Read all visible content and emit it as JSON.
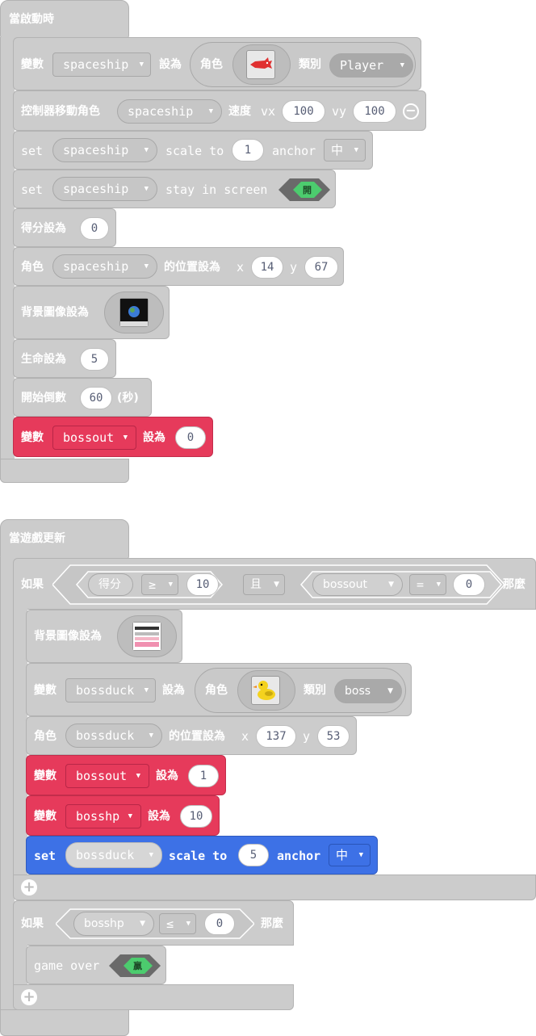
{
  "on_start": {
    "title": "當啟動時",
    "rows": {
      "var_label": "變數",
      "var_value": "spaceship",
      "set_to": "設為",
      "sprite_label": "角色",
      "kind_label": "類別",
      "kind_value": "Player",
      "controller": "控制器移動角色",
      "controller_var": "spaceship",
      "speed": "速度",
      "vx": "vx",
      "vx_val": "100",
      "vy": "vy",
      "vy_val": "100",
      "set": "set",
      "scale_var": "spaceship",
      "scale_to": "scale to",
      "scale_val": "1",
      "anchor": "anchor",
      "anchor_val": "中",
      "stay_var": "spaceship",
      "stay_text": "stay in screen",
      "stay_toggle": "開",
      "score": "得分設為",
      "score_val": "0",
      "pos_label": "角色",
      "pos_var": "spaceship",
      "pos_set": "的位置設為",
      "pos_x": "x",
      "pos_x_val": "14",
      "pos_y": "y",
      "pos_y_val": "67",
      "bg": "背景圖像設為",
      "life": "生命設為",
      "life_val": "5",
      "countdown": "開始倒數",
      "countdown_val": "60",
      "countdown_unit": "(秒)",
      "bossout_var_label": "變數",
      "bossout_var": "bossout",
      "bossout_set": "設為",
      "bossout_val": "0"
    }
  },
  "on_update": {
    "title": "當遊戲更新",
    "if1": {
      "if_label": "如果",
      "score_reporter": "得分",
      "op1": "≥",
      "val1": "10",
      "and": "且",
      "bossout_reporter": "bossout",
      "op2": "=",
      "val2": "0",
      "then": "那麼"
    },
    "inner": {
      "bg": "背景圖像設為",
      "var_label": "變數",
      "var_value": "bossduck",
      "set_to": "設為",
      "sprite_label": "角色",
      "kind_label": "類別",
      "kind_value": "boss",
      "pos_label": "角色",
      "pos_var": "bossduck",
      "pos_set": "的位置設為",
      "pos_x": "x",
      "pos_x_val": "137",
      "pos_y": "y",
      "pos_y_val": "53",
      "bossout_label": "變數",
      "bossout_var": "bossout",
      "bossout_set": "設為",
      "bossout_val": "1",
      "bosshp_label": "變數",
      "bosshp_var": "bosshp",
      "bosshp_set": "設為",
      "bosshp_val": "10",
      "set": "set",
      "scale_var": "bossduck",
      "scale_to": "scale to",
      "scale_val": "5",
      "anchor": "anchor",
      "anchor_val": "中"
    },
    "if2": {
      "if_label": "如果",
      "reporter": "bosshp",
      "op": "≤",
      "val": "0",
      "then": "那麼",
      "game_over": "game over",
      "toggle": "贏"
    }
  },
  "colors": {
    "block_grey": "#cccccc",
    "variables_red": "#e63a5b",
    "sprites_blue": "#3d71e6",
    "toggle_green": "#4ccc6e"
  }
}
